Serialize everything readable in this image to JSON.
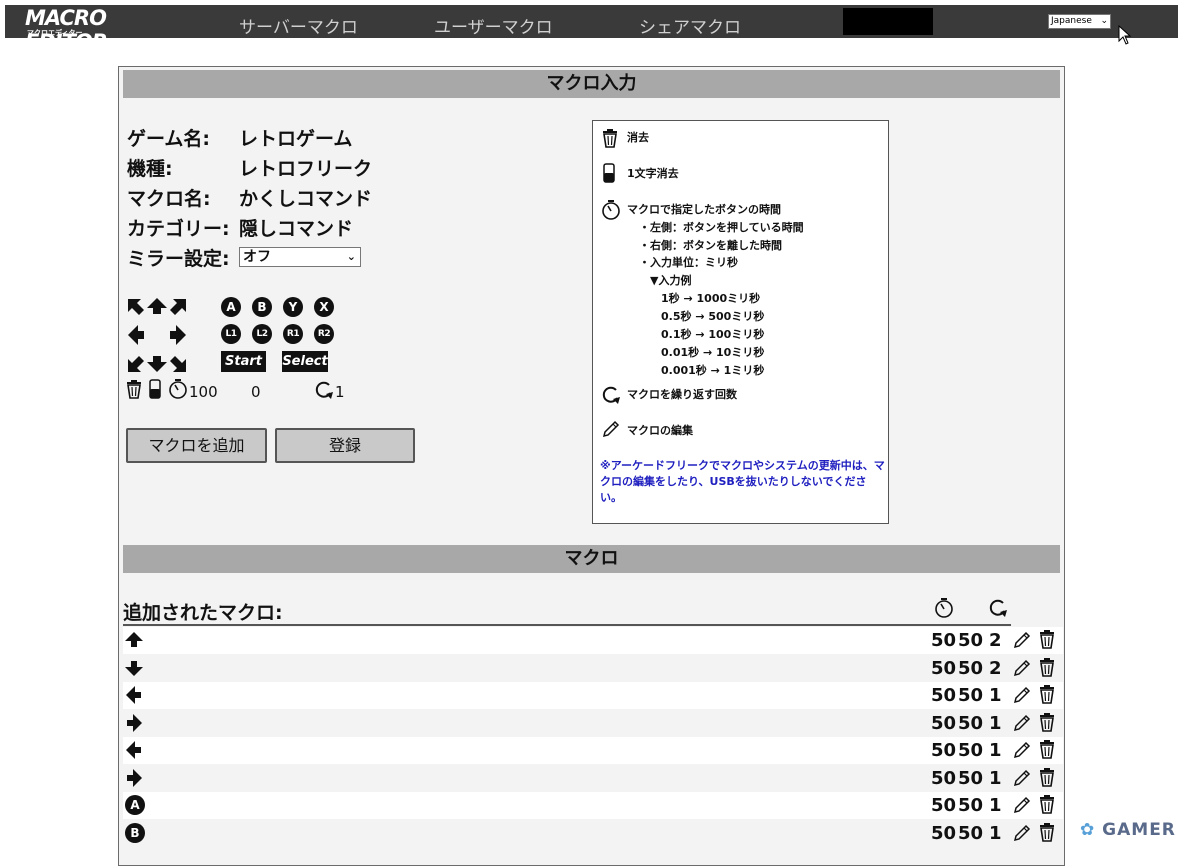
{
  "header": {
    "logo_main": "MACRO EDITOR",
    "logo_sub": "マクロエディター",
    "nav": [
      "サーバーマクロ",
      "ユーザーマクロ",
      "シェアマクロ"
    ],
    "language": "Japanese"
  },
  "input_section": {
    "title": "マクロ入力",
    "game_label": "ゲーム名:",
    "game_value": "レトロゲーム",
    "model_label": "機種:",
    "model_value": "レトロフリーク",
    "macro_label": "マクロ名:",
    "macro_value": "かくしコマンド",
    "category_label": "カテゴリー:",
    "category_value": "隠しコマンド",
    "mirror_label": "ミラー設定:",
    "mirror_value": "オフ",
    "buttons": {
      "a": "A",
      "b": "B",
      "y": "Y",
      "x": "X",
      "l1": "L1",
      "l2": "L2",
      "r1": "R1",
      "r2": "R2",
      "start": "Start",
      "select": "Select"
    },
    "hold_time": "100",
    "release_time": "0",
    "repeat": "1",
    "add_button": "マクロを追加",
    "register_button": "登録"
  },
  "help": {
    "delete": "消去",
    "delete_char": "1文字消去",
    "timer": "マクロで指定したボタンの時間",
    "left": "・左側：ボタンを押している時間",
    "right": "・右側：ボタンを離した時間",
    "unit": "・入力単位：ミリ秒",
    "example_title": "▼入力例",
    "examples": [
      "1秒 → 1000ミリ秒",
      "0.5秒 → 500ミリ秒",
      "0.1秒 → 100ミリ秒",
      "0.01秒 → 10ミリ秒",
      "0.001秒 → 1ミリ秒"
    ],
    "repeat": "マクロを繰り返す回数",
    "edit": "マクロの編集",
    "note": "※アーケードフリークでマクロやシステムの更新中は、マクロの編集をしたり、USBを抜いたりしないでください。"
  },
  "macro_section": {
    "title": "マクロ",
    "list_title": "追加されたマクロ:",
    "rows": [
      {
        "input": "up",
        "press": "50",
        "release": "50",
        "repeat": "2"
      },
      {
        "input": "down",
        "press": "50",
        "release": "50",
        "repeat": "2"
      },
      {
        "input": "left",
        "press": "50",
        "release": "50",
        "repeat": "1"
      },
      {
        "input": "right",
        "press": "50",
        "release": "50",
        "repeat": "1"
      },
      {
        "input": "left",
        "press": "50",
        "release": "50",
        "repeat": "1"
      },
      {
        "input": "right",
        "press": "50",
        "release": "50",
        "repeat": "1"
      },
      {
        "input": "A",
        "press": "50",
        "release": "50",
        "repeat": "1"
      },
      {
        "input": "B",
        "press": "50",
        "release": "50",
        "repeat": "1"
      }
    ]
  },
  "watermark": "GAMER"
}
